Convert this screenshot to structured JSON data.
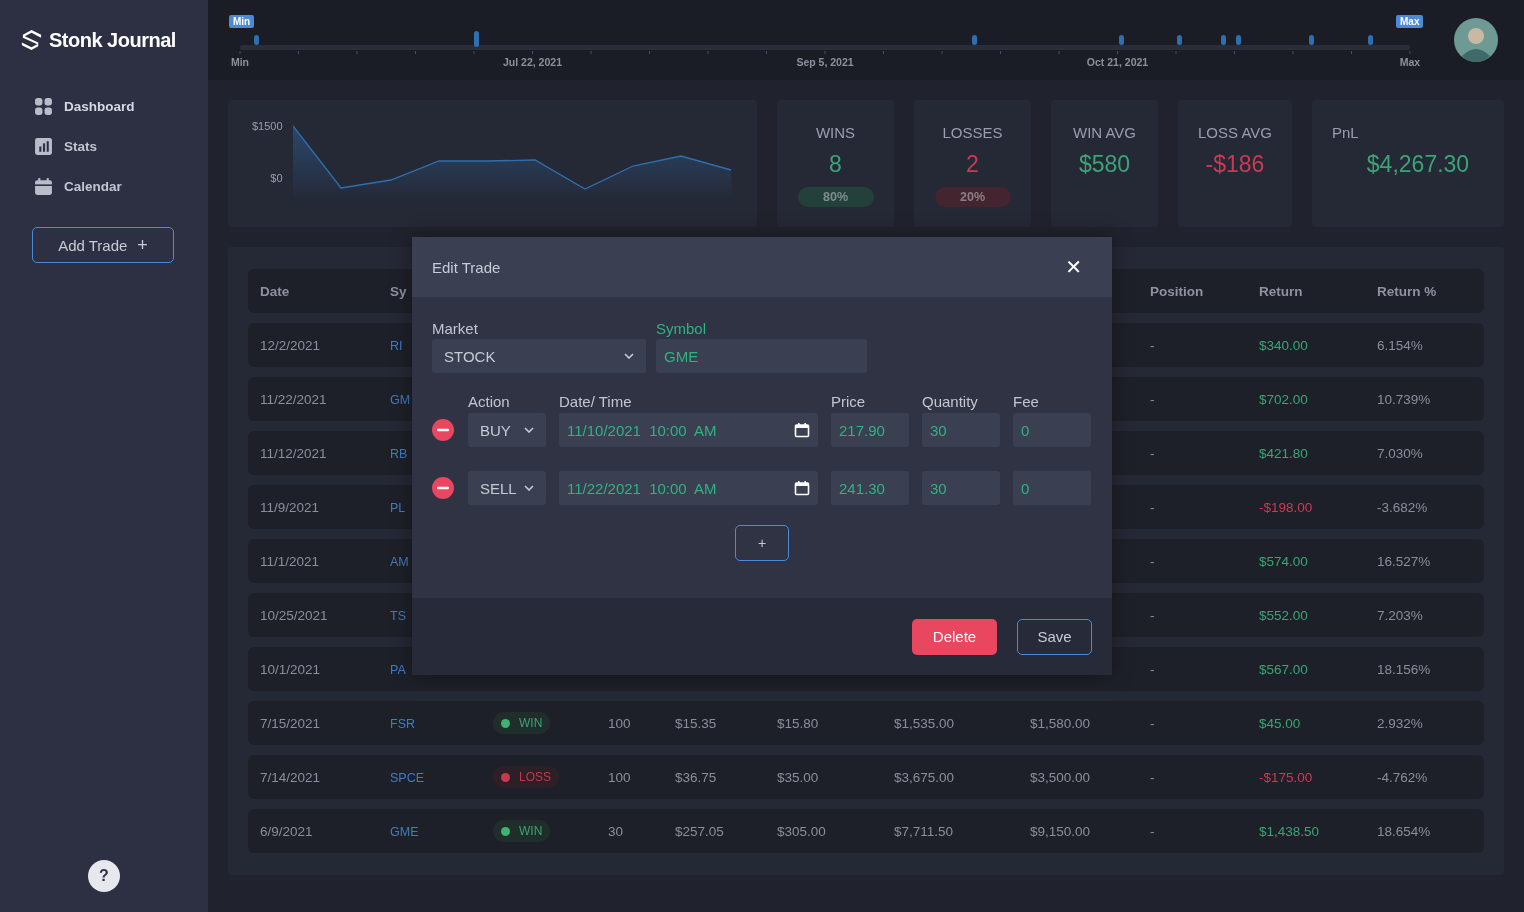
{
  "brand": {
    "name": "Stonk Journal"
  },
  "sidebar": {
    "items": [
      {
        "label": "Dashboard",
        "selected": true
      },
      {
        "label": "Stats",
        "selected": false
      },
      {
        "label": "Calendar",
        "selected": false
      }
    ],
    "add_button": "Add Trade",
    "add_icon": "+",
    "help_icon": "?"
  },
  "timeline": {
    "min_badge": "Min",
    "max_badge": "Max",
    "axis_labels": [
      "Min",
      "Jul 22, 2021",
      "Sep 5, 2021",
      "Oct 21, 2021",
      "Max"
    ]
  },
  "pnl_chart": {
    "kind": "picture",
    "y_labels": [
      "$1500",
      "$0"
    ]
  },
  "stats": [
    {
      "label": "WINS",
      "value": "8",
      "negative": false,
      "pill": "80%"
    },
    {
      "label": "LOSSES",
      "value": "2",
      "negative": true,
      "pill": "20%"
    },
    {
      "label": "WIN AVG",
      "value": "$580",
      "negative": false
    },
    {
      "label": "LOSS AVG",
      "value": "-$186",
      "negative": true
    },
    {
      "label": "PnL",
      "value": "$4,267.30",
      "negative": false
    }
  ],
  "table": {
    "header": {
      "date": "Date",
      "symbol": "Sy",
      "position": "Position",
      "return": "Return",
      "return_pct": "Return %"
    },
    "rows": [
      {
        "date": "12/2/2021",
        "symbol": "RI",
        "position": "-",
        "return": "$340.00",
        "negative": false,
        "return_pct": "6.154%"
      },
      {
        "date": "11/22/2021",
        "symbol": "GM",
        "position": "-",
        "return": "$702.00",
        "negative": false,
        "return_pct": "10.739%"
      },
      {
        "date": "11/12/2021",
        "symbol": "RB",
        "position": "-",
        "return": "$421.80",
        "negative": false,
        "return_pct": "7.030%"
      },
      {
        "date": "11/9/2021",
        "symbol": "PL",
        "position": "-",
        "return": "-$198.00",
        "negative": true,
        "return_pct": "-3.682%"
      },
      {
        "date": "11/1/2021",
        "symbol": "AM",
        "position": "-",
        "return": "$574.00",
        "negative": false,
        "return_pct": "16.527%"
      },
      {
        "date": "10/25/2021",
        "symbol": "TS",
        "position": "-",
        "return": "$552.00",
        "negative": false,
        "return_pct": "7.203%"
      },
      {
        "date": "10/1/2021",
        "symbol": "PA",
        "position": "-",
        "return": "$567.00",
        "negative": false,
        "return_pct": "18.156%"
      },
      {
        "date": "7/15/2021",
        "symbol": "FSR",
        "status": {
          "kind": "win",
          "label": "WIN"
        },
        "quantity": "100",
        "entry": "$15.35",
        "exit": "$15.80",
        "cost": "$1,535.00",
        "proceeds": "$1,580.00",
        "position": "-",
        "return": "$45.00",
        "negative": false,
        "return_pct": "2.932%"
      },
      {
        "date": "7/14/2021",
        "symbol": "SPCE",
        "status": {
          "kind": "loss",
          "label": "LOSS"
        },
        "quantity": "100",
        "entry": "$36.75",
        "exit": "$35.00",
        "cost": "$3,675.00",
        "proceeds": "$3,500.00",
        "position": "-",
        "return": "-$175.00",
        "negative": true,
        "return_pct": "-4.762%"
      },
      {
        "date": "6/9/2021",
        "symbol": "GME",
        "status": {
          "kind": "win",
          "label": "WIN"
        },
        "quantity": "30",
        "entry": "$257.05",
        "exit": "$305.00",
        "cost": "$7,711.50",
        "proceeds": "$9,150.00",
        "position": "-",
        "return": "$1,438.50",
        "negative": false,
        "return_pct": "18.654%"
      }
    ]
  },
  "modal": {
    "title": "Edit Trade",
    "close": "✕",
    "market": {
      "label": "Market",
      "value": "STOCK",
      "focused": false
    },
    "symbol": {
      "label": "Symbol",
      "value": "GME",
      "focused": true
    },
    "legs_header": [
      "Action",
      "Date/ Time",
      "Price",
      "Quantity",
      "Fee"
    ],
    "legs": [
      {
        "action": "BUY",
        "datetime": "11/10/2021 10:00 AM",
        "price": "217.90",
        "quantity": "30",
        "fee": "0"
      },
      {
        "action": "SELL",
        "datetime": "11/22/2021 10:00 AM",
        "price": "241.30",
        "quantity": "30",
        "fee": "0"
      }
    ],
    "add_leg": "+",
    "delete": "Delete",
    "save": "Save"
  }
}
